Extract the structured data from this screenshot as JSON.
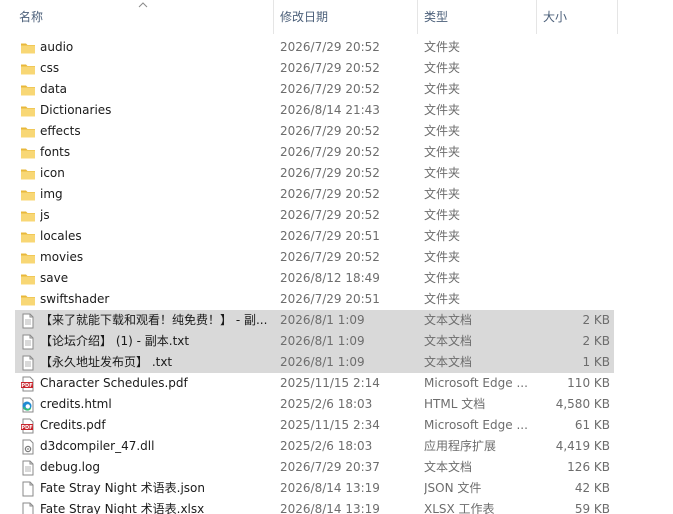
{
  "columns": {
    "name": "名称",
    "date": "修改日期",
    "type": "类型",
    "size": "大小"
  },
  "files": [
    {
      "name": "audio",
      "date": "2026/7/29 20:52",
      "type": "文件夹",
      "size": "",
      "icon": "folder-icon",
      "selected": false
    },
    {
      "name": "css",
      "date": "2026/7/29 20:52",
      "type": "文件夹",
      "size": "",
      "icon": "folder-icon",
      "selected": false
    },
    {
      "name": "data",
      "date": "2026/7/29 20:52",
      "type": "文件夹",
      "size": "",
      "icon": "folder-icon",
      "selected": false
    },
    {
      "name": "Dictionaries",
      "date": "2026/8/14 21:43",
      "type": "文件夹",
      "size": "",
      "icon": "folder-icon",
      "selected": false
    },
    {
      "name": "effects",
      "date": "2026/7/29 20:52",
      "type": "文件夹",
      "size": "",
      "icon": "folder-icon",
      "selected": false
    },
    {
      "name": "fonts",
      "date": "2026/7/29 20:52",
      "type": "文件夹",
      "size": "",
      "icon": "folder-icon",
      "selected": false
    },
    {
      "name": "icon",
      "date": "2026/7/29 20:52",
      "type": "文件夹",
      "size": "",
      "icon": "folder-icon",
      "selected": false
    },
    {
      "name": "img",
      "date": "2026/7/29 20:52",
      "type": "文件夹",
      "size": "",
      "icon": "folder-icon",
      "selected": false
    },
    {
      "name": "js",
      "date": "2026/7/29 20:52",
      "type": "文件夹",
      "size": "",
      "icon": "folder-icon",
      "selected": false
    },
    {
      "name": "locales",
      "date": "2026/7/29 20:51",
      "type": "文件夹",
      "size": "",
      "icon": "folder-icon",
      "selected": false
    },
    {
      "name": "movies",
      "date": "2026/7/29 20:52",
      "type": "文件夹",
      "size": "",
      "icon": "folder-icon",
      "selected": false
    },
    {
      "name": "save",
      "date": "2026/8/12 18:49",
      "type": "文件夹",
      "size": "",
      "icon": "folder-icon",
      "selected": false
    },
    {
      "name": "swiftshader",
      "date": "2026/7/29 20:51",
      "type": "文件夹",
      "size": "",
      "icon": "folder-icon",
      "selected": false
    },
    {
      "name": "【来了就能下载和观看！纯免费！】 - 副...",
      "date": "2026/8/1 1:09",
      "type": "文本文档",
      "size": "2 KB",
      "icon": "text-file-icon",
      "selected": true
    },
    {
      "name": "【论坛介绍】 (1) - 副本.txt",
      "date": "2026/8/1 1:09",
      "type": "文本文档",
      "size": "2 KB",
      "icon": "text-file-icon",
      "selected": true
    },
    {
      "name": "【永久地址发布页】 .txt",
      "date": "2026/8/1 1:09",
      "type": "文本文档",
      "size": "1 KB",
      "icon": "text-file-icon",
      "selected": true
    },
    {
      "name": "Character Schedules.pdf",
      "date": "2025/11/15 2:14",
      "type": "Microsoft Edge ...",
      "size": "110 KB",
      "icon": "pdf-icon",
      "selected": false
    },
    {
      "name": "credits.html",
      "date": "2025/2/6 18:03",
      "type": "HTML 文档",
      "size": "4,580 KB",
      "icon": "edge-html-icon",
      "selected": false
    },
    {
      "name": "Credits.pdf",
      "date": "2025/11/15 2:34",
      "type": "Microsoft Edge ...",
      "size": "61 KB",
      "icon": "pdf-icon",
      "selected": false
    },
    {
      "name": "d3dcompiler_47.dll",
      "date": "2025/2/6 18:03",
      "type": "应用程序扩展",
      "size": "4,419 KB",
      "icon": "dll-file-icon",
      "selected": false
    },
    {
      "name": "debug.log",
      "date": "2026/7/29 20:37",
      "type": "文本文档",
      "size": "126 KB",
      "icon": "text-file-icon",
      "selected": false
    },
    {
      "name": "Fate Stray Night 术语表.json",
      "date": "2026/8/14 13:19",
      "type": "JSON 文件",
      "size": "42 KB",
      "icon": "blank-file-icon",
      "selected": false
    },
    {
      "name": "Fate Stray Night 术语表.xlsx",
      "date": "2026/8/14 13:19",
      "type": "XLSX 工作表",
      "size": "59 KB",
      "icon": "blank-file-icon",
      "selected": false
    }
  ],
  "colors": {
    "folder": "#f8d775",
    "folder_dark": "#e8b83c",
    "pdf": "#c8242b",
    "selection": "#d9d9d9",
    "header_text": "#4c607a",
    "meta_text": "#6d6d6d"
  }
}
